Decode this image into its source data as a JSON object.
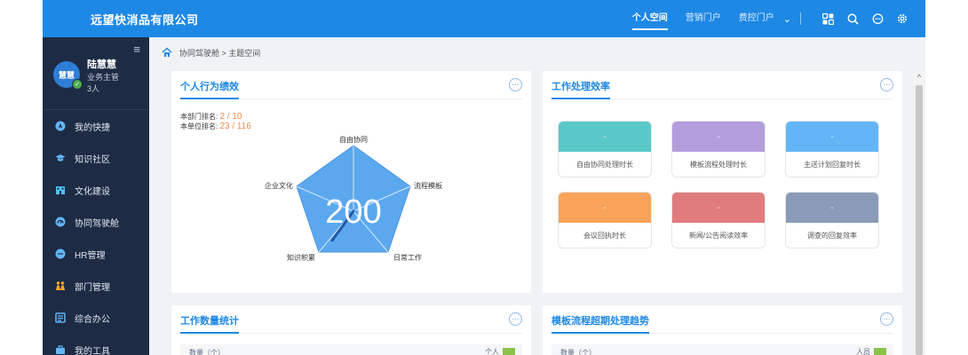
{
  "header": {
    "brand": "远望快消品有限公司",
    "nav": [
      "个人空间",
      "营销门户",
      "费控门户"
    ],
    "active_nav": "个人空间"
  },
  "sidebar": {
    "user": {
      "name": "陆慧慧",
      "avatar_text": "慧慧",
      "role": "业务主管",
      "count": "3人"
    },
    "items": [
      {
        "label": "我的快捷",
        "icon": "compass-icon"
      },
      {
        "label": "知识社区",
        "icon": "graduation-cap-icon"
      },
      {
        "label": "文化建设",
        "icon": "building-icon"
      },
      {
        "label": "协同驾驶舱",
        "icon": "cockpit-icon"
      },
      {
        "label": "HR管理",
        "icon": "chat-icon"
      },
      {
        "label": "部门管理",
        "icon": "people-icon"
      },
      {
        "label": "综合办公",
        "icon": "office-icon"
      },
      {
        "label": "我的工具",
        "icon": "toolbox-icon"
      }
    ]
  },
  "breadcrumb": "协同驾驶舱 > 主题空间",
  "performance": {
    "title": "个人行为绩效",
    "dept_rank_label": "本部门排名:",
    "dept_rank_value": "2 / 10",
    "unit_rank_label": "本单位排名:",
    "unit_rank_value": "23 / 116",
    "score": "200",
    "radar_axes": [
      "自由协同",
      "流程模板",
      "日常工作",
      "知识积累",
      "企业文化"
    ],
    "radar_values": [
      0,
      0,
      0,
      0.55,
      0
    ]
  },
  "efficiency": {
    "title": "工作处理效率",
    "tiles": [
      {
        "label": "自由协同处理时长",
        "value": "-",
        "color": "#5ac8c8"
      },
      {
        "label": "模板流程处理时长",
        "value": "-",
        "color": "#b39ddb"
      },
      {
        "label": "主送计划回复时长",
        "value": "-",
        "color": "#64b5f6"
      },
      {
        "label": "会议回执时长",
        "value": "-",
        "color": "#f9a25a"
      },
      {
        "label": "新闻/公告阅读效率",
        "value": "-",
        "color": "#e07b7e"
      },
      {
        "label": "调查的回复效率",
        "value": "-",
        "color": "#8a9bb8"
      }
    ]
  },
  "count_stats": {
    "title": "工作数量统计",
    "ylabel": "数量（个）",
    "legend": "个人"
  },
  "overtime_trend": {
    "title": "模板流程超期处理趋势",
    "ylabel": "数量（个）",
    "legend": "人员"
  },
  "colors": {
    "primary": "#1e88e5",
    "sidebar": "#1d2b45",
    "accent_orange": "#f08c4d",
    "legend_green": "#8bc34a"
  }
}
